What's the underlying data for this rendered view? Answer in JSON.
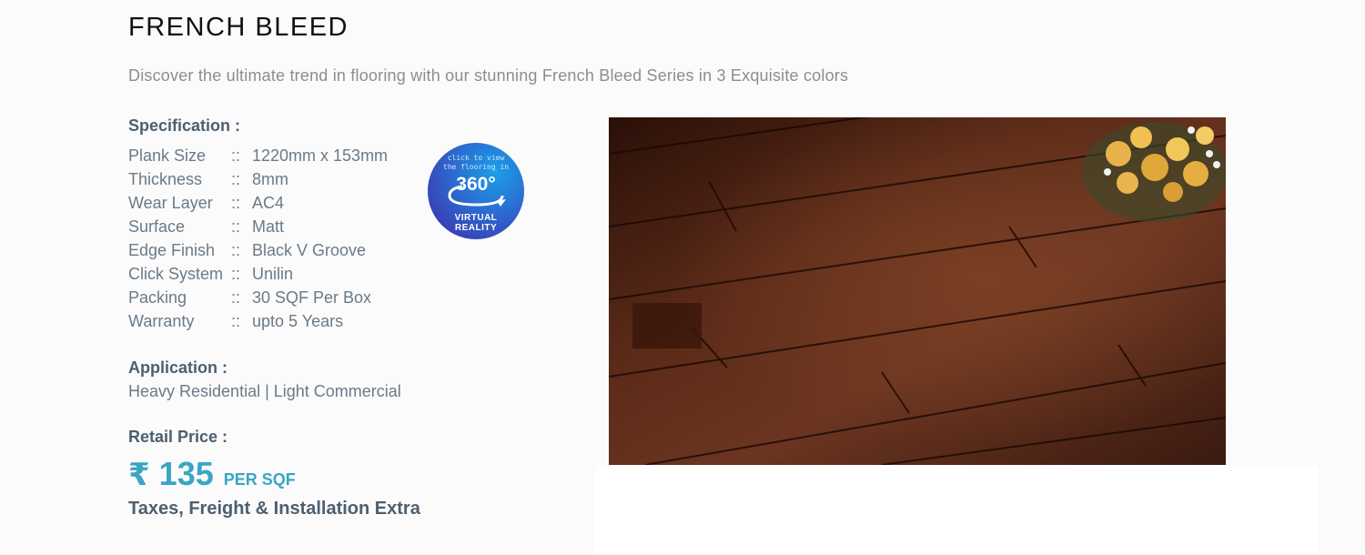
{
  "product": {
    "title": "FRENCH BLEED",
    "subtitle": "Discover the ultimate trend in flooring with our stunning French Bleed Series in 3 Exquisite colors"
  },
  "specification": {
    "heading": "Specification :",
    "separator": "::",
    "rows": [
      {
        "key": "Plank Size",
        "value": "1220mm x 153mm"
      },
      {
        "key": "Thickness",
        "value": "8mm"
      },
      {
        "key": "Wear Layer",
        "value": "AC4"
      },
      {
        "key": "Surface",
        "value": "Matt"
      },
      {
        "key": "Edge Finish",
        "value": "Black V Groove"
      },
      {
        "key": "Click System",
        "value": "Unilin"
      },
      {
        "key": "Packing",
        "value": "30 SQF Per Box"
      },
      {
        "key": "Warranty",
        "value": "upto 5 Years"
      }
    ]
  },
  "application": {
    "heading": "Application :",
    "text": "Heavy Residential | Light Commercial"
  },
  "price": {
    "heading": "Retail Price :",
    "currency": "₹",
    "amount": "135",
    "unit": "PER SQF",
    "note": "Taxes, Freight & Installation Extra"
  },
  "vr_badge": {
    "line1": "click to view",
    "line2": "the flooring in",
    "number": "360°",
    "line3": "VIRTUAL",
    "line4": "REALITY"
  },
  "colors": {
    "accent": "#3aa6c4",
    "heading": "#4c5f70",
    "floor": "#3a1a10"
  }
}
